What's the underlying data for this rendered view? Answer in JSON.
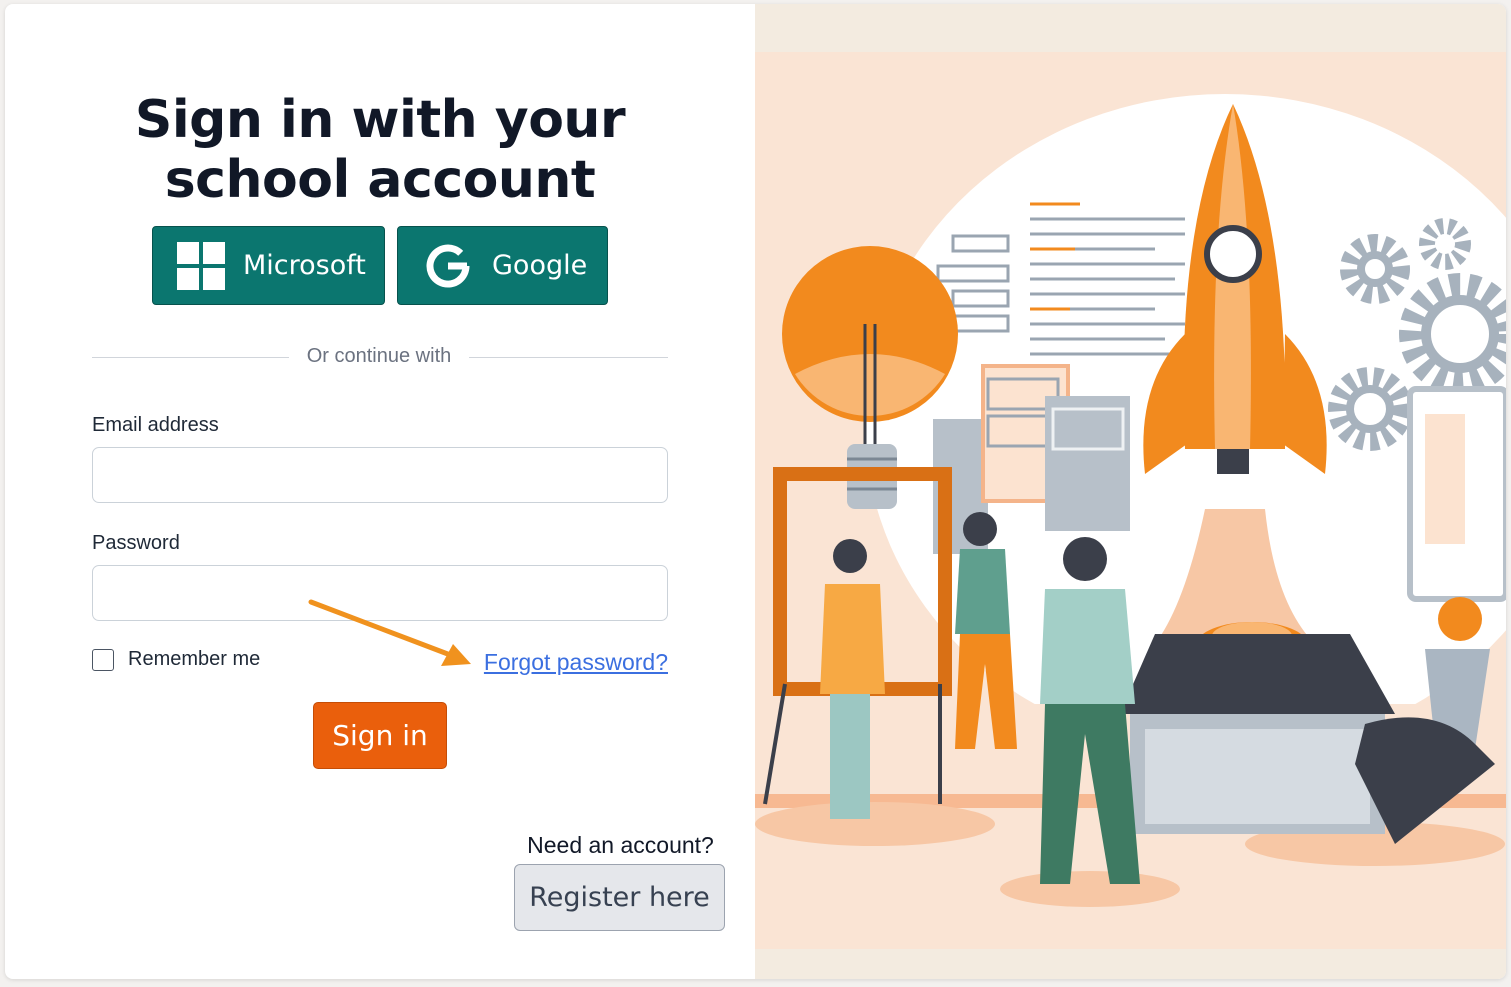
{
  "heading": {
    "line1": "Sign in with your",
    "line2": "school account"
  },
  "sso": {
    "microsoft_label": "Microsoft",
    "google_label": "Google",
    "button_color": "#0b766f"
  },
  "divider_text": "Or continue with",
  "form": {
    "email_label": "Email address",
    "email_value": "",
    "password_label": "Password",
    "password_value": "",
    "remember_label": "Remember me",
    "remember_checked": false,
    "forgot_label": "Forgot password?",
    "signin_label": "Sign in",
    "signin_color": "#ea5f0c"
  },
  "register": {
    "prompt": "Need an account?",
    "button_label": "Register here"
  },
  "illustration": {
    "icons": [
      "lightbulb-icon",
      "rocket-icon",
      "gear-icon",
      "document-icon",
      "launch-pad-icon"
    ],
    "accent": "#f28a1e"
  }
}
